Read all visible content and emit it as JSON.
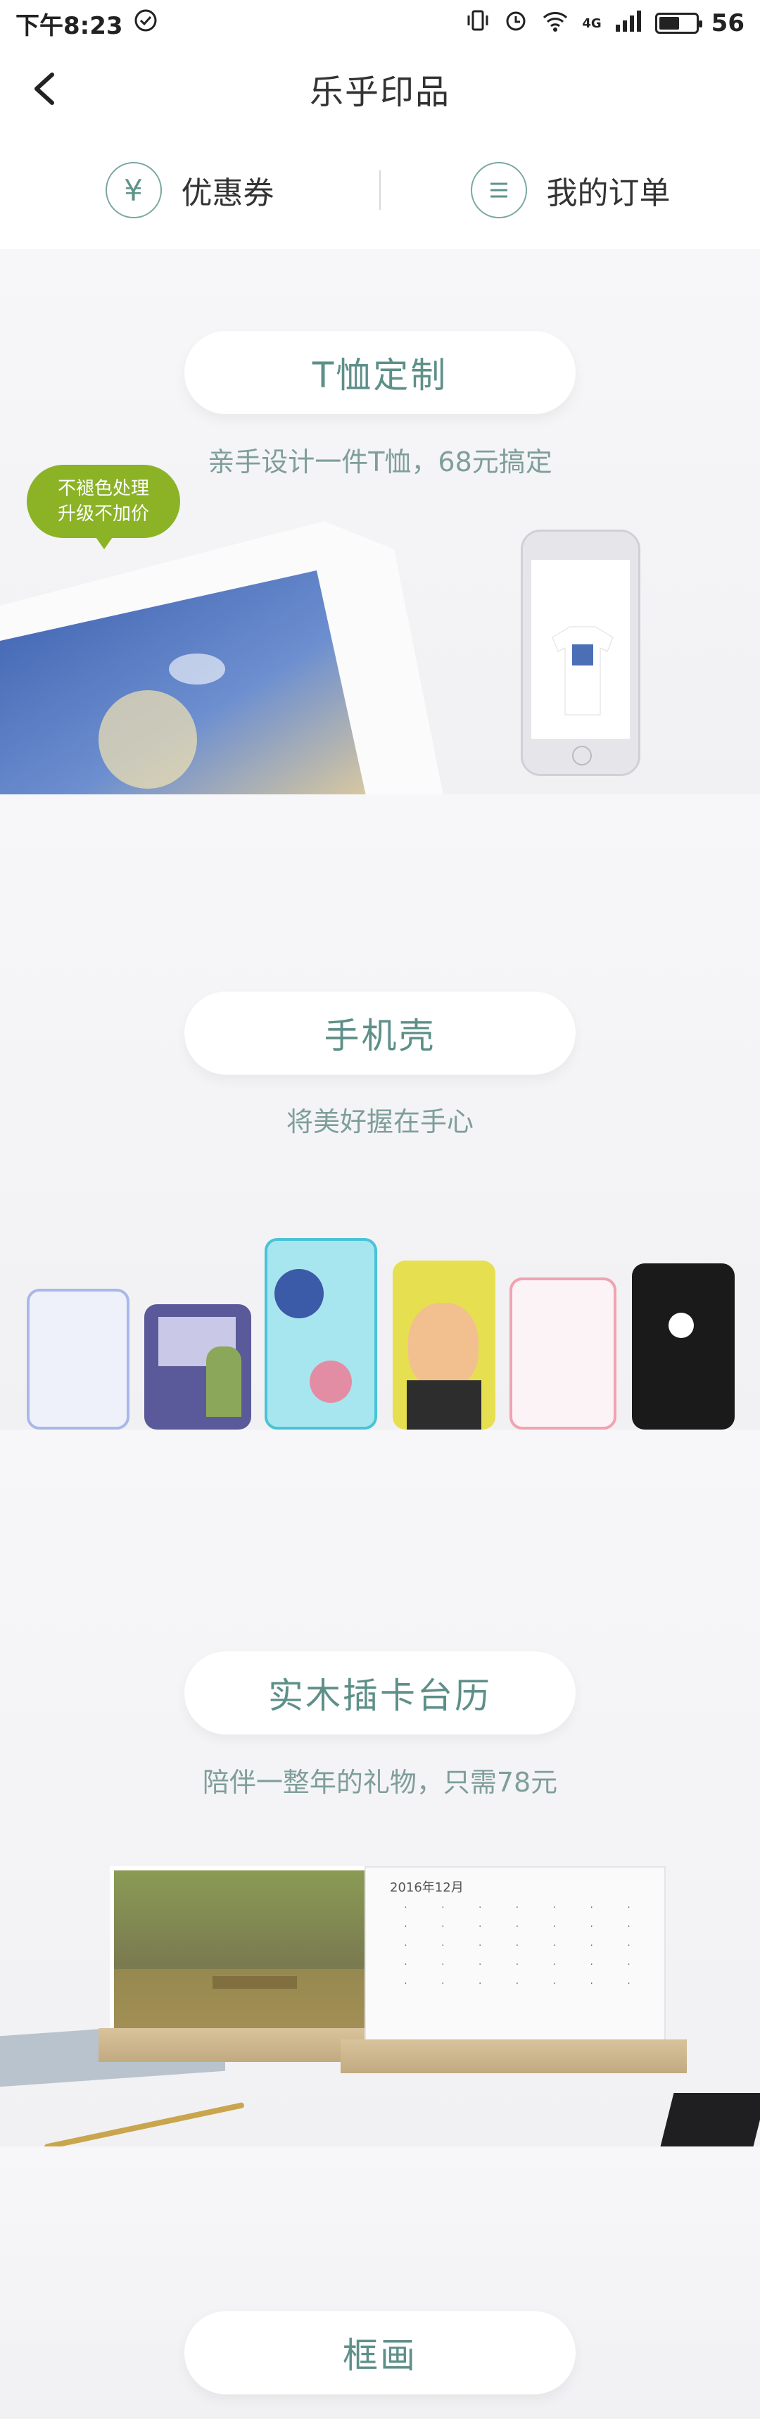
{
  "status_bar": {
    "time": "下午8:23",
    "network": "4G",
    "battery": "56",
    "battery_level": 0.56
  },
  "header": {
    "title": "乐乎印品"
  },
  "tabs": [
    {
      "label": "优惠券",
      "icon": "yuan-circle-icon"
    },
    {
      "label": "我的订单",
      "icon": "list-circle-icon"
    }
  ],
  "sections": [
    {
      "title": "T恤定制",
      "subtitle": "亲手设计一件T恤，68元搞定",
      "badge": [
        "不褪色处理",
        "升级不加价"
      ]
    },
    {
      "title": "手机壳",
      "subtitle": "将美好握在手心"
    },
    {
      "title": "实木插卡台历",
      "subtitle": "陪伴一整年的礼物，只需78元",
      "calendar_heading": "2016年12月"
    },
    {
      "title": "框画"
    }
  ],
  "colors": {
    "accent": "#5e8f89",
    "badge_green": "#8bb325",
    "background": "#f4f4f6"
  }
}
